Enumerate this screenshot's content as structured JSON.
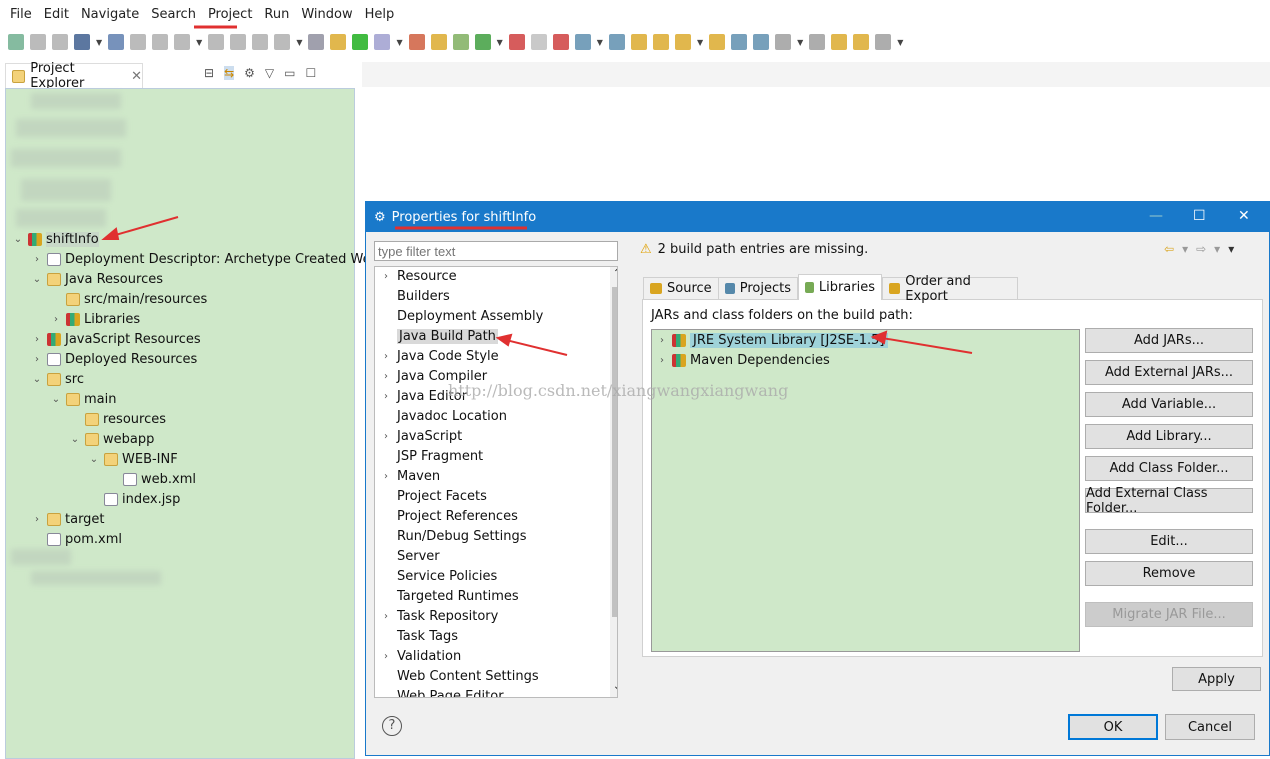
{
  "menu": [
    "File",
    "Edit",
    "Navigate",
    "Search",
    "Project",
    "Run",
    "Window",
    "Help"
  ],
  "explorer": {
    "tab_label": "Project Explorer",
    "tree": [
      {
        "label": "shiftInfo",
        "depth": 0,
        "tw": "v",
        "icon": "project-icon",
        "sel": true
      },
      {
        "label": "Deployment Descriptor: Archetype Created Web ...",
        "depth": 1,
        "tw": ">",
        "icon": "descriptor-icon"
      },
      {
        "label": "Java Resources",
        "depth": 1,
        "tw": "v",
        "icon": "java-resources-icon"
      },
      {
        "label": "src/main/resources",
        "depth": 2,
        "tw": "",
        "icon": "source-folder-icon"
      },
      {
        "label": "Libraries",
        "depth": 2,
        "tw": ">",
        "icon": "library-icon"
      },
      {
        "label": "JavaScript Resources",
        "depth": 1,
        "tw": ">",
        "icon": "library-icon"
      },
      {
        "label": "Deployed Resources",
        "depth": 1,
        "tw": ">",
        "icon": "deployed-icon"
      },
      {
        "label": "src",
        "depth": 1,
        "tw": "v",
        "icon": "folder-icon"
      },
      {
        "label": "main",
        "depth": 2,
        "tw": "v",
        "icon": "folder-icon"
      },
      {
        "label": "resources",
        "depth": 3,
        "tw": "",
        "icon": "folder-icon"
      },
      {
        "label": "webapp",
        "depth": 3,
        "tw": "v",
        "icon": "folder-icon"
      },
      {
        "label": "WEB-INF",
        "depth": 4,
        "tw": "v",
        "icon": "folder-icon"
      },
      {
        "label": "web.xml",
        "depth": 5,
        "tw": "",
        "icon": "xml-file-icon"
      },
      {
        "label": "index.jsp",
        "depth": 4,
        "tw": "",
        "icon": "file-icon"
      },
      {
        "label": "target",
        "depth": 1,
        "tw": ">",
        "icon": "folder-icon"
      },
      {
        "label": "pom.xml",
        "depth": 1,
        "tw": "",
        "icon": "maven-file-icon"
      }
    ]
  },
  "dialog": {
    "title": "Properties for shiftInfo",
    "filter_placeholder": "type filter text",
    "nav": [
      {
        "label": "Resource",
        "tw": ">"
      },
      {
        "label": "Builders",
        "tw": ""
      },
      {
        "label": "Deployment Assembly",
        "tw": ""
      },
      {
        "label": "Java Build Path",
        "tw": "",
        "sel": true
      },
      {
        "label": "Java Code Style",
        "tw": ">"
      },
      {
        "label": "Java Compiler",
        "tw": ">"
      },
      {
        "label": "Java Editor",
        "tw": ">"
      },
      {
        "label": "Javadoc Location",
        "tw": ""
      },
      {
        "label": "JavaScript",
        "tw": ">"
      },
      {
        "label": "JSP Fragment",
        "tw": ""
      },
      {
        "label": "Maven",
        "tw": ">"
      },
      {
        "label": "Project Facets",
        "tw": ""
      },
      {
        "label": "Project References",
        "tw": ""
      },
      {
        "label": "Run/Debug Settings",
        "tw": ""
      },
      {
        "label": "Server",
        "tw": ""
      },
      {
        "label": "Service Policies",
        "tw": ""
      },
      {
        "label": "Targeted Runtimes",
        "tw": ""
      },
      {
        "label": "Task Repository",
        "tw": ">"
      },
      {
        "label": "Task Tags",
        "tw": ""
      },
      {
        "label": "Validation",
        "tw": ">"
      },
      {
        "label": "Web Content Settings",
        "tw": ""
      },
      {
        "label": "Web Page Editor",
        "tw": ""
      }
    ],
    "message": "2 build path entries are missing.",
    "tabs": [
      {
        "label": "Source"
      },
      {
        "label": "Projects"
      },
      {
        "label": "Libraries",
        "active": true
      },
      {
        "label": "Order and Export"
      }
    ],
    "content_label": "JARs and class folders on the build path:",
    "libraries": [
      "JRE System Library [J2SE-1.5]",
      "Maven Dependencies"
    ],
    "buttons": [
      "Add JARs...",
      "Add External JARs...",
      "Add Variable...",
      "Add Library...",
      "Add Class Folder...",
      "Add External Class Folder...",
      "Edit...",
      "Remove",
      "Migrate JAR File..."
    ],
    "apply": "Apply",
    "ok": "OK",
    "cancel": "Cancel"
  },
  "watermark": "http://blog.csdn.net/xiangwangxiangwang",
  "colors": {
    "title_bar": "#1979ca",
    "tree_bg": "#cfe8c9",
    "annotation": "#e03030"
  }
}
